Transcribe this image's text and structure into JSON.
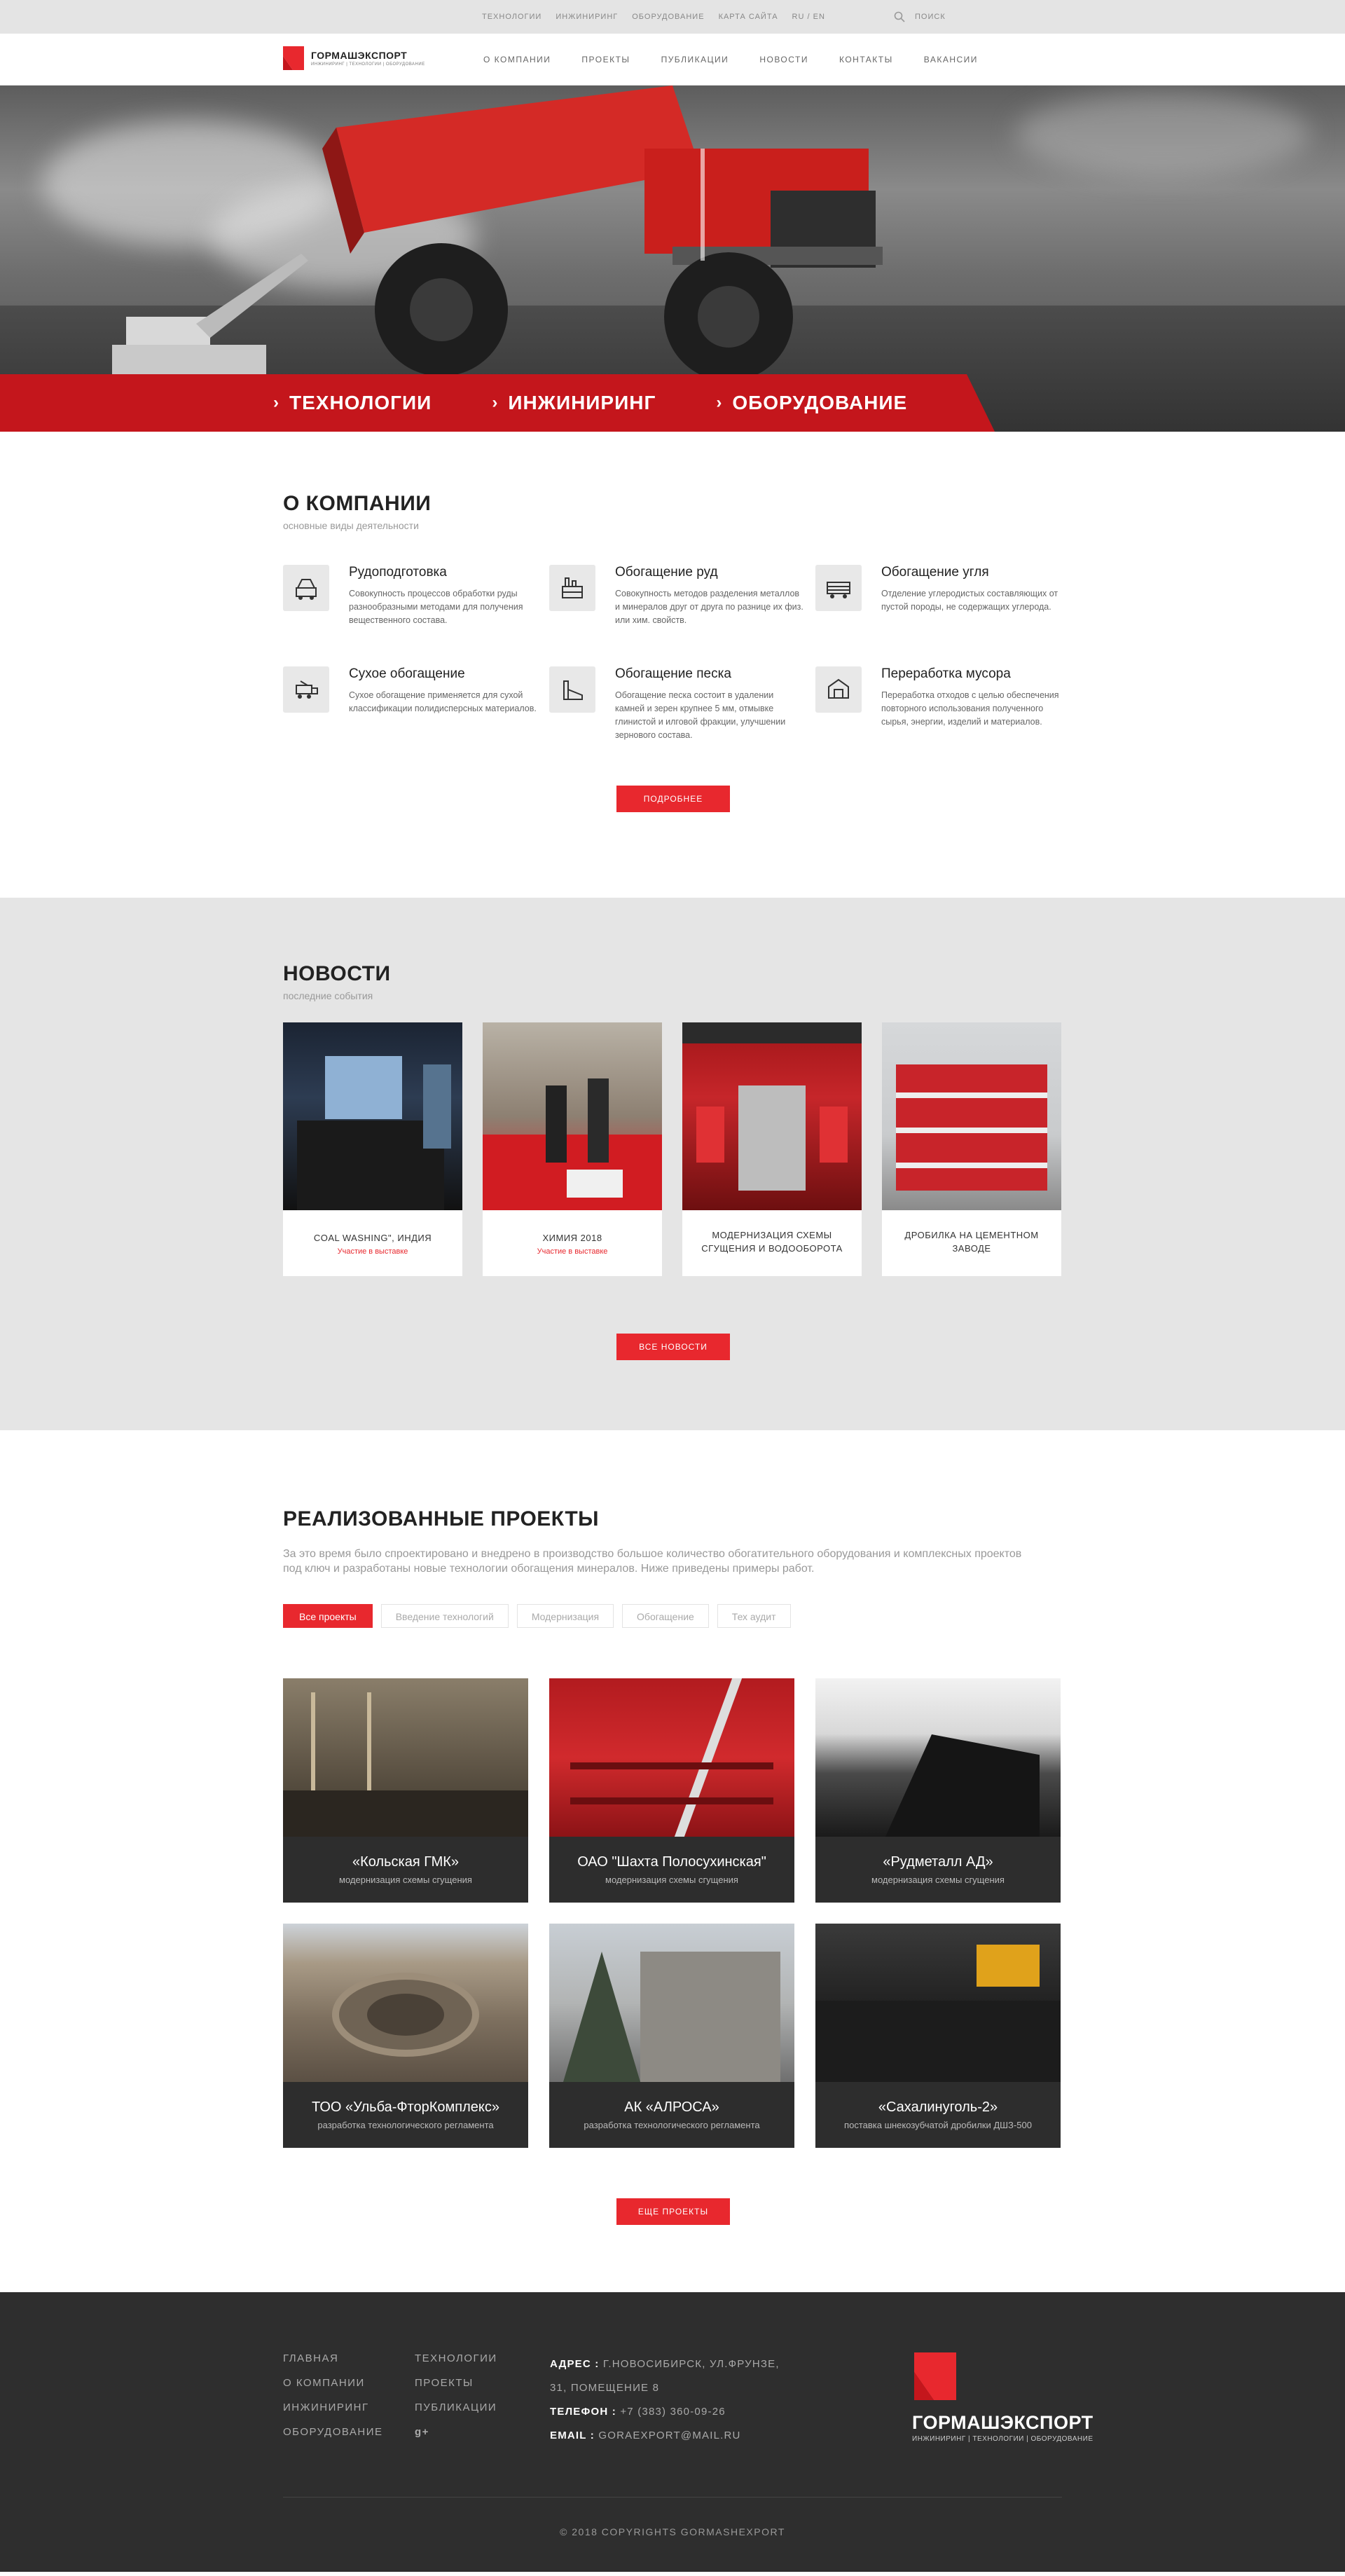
{
  "topbar": {
    "links": [
      "ТЕХНОЛОГИИ",
      "ИНЖИНИРИНГ",
      "ОБОРУДОВАНИЕ",
      "КАРТА САЙТА",
      "RU / EN"
    ],
    "search_label": "ПОИСК"
  },
  "header": {
    "logo_name": "ГОРМАШЭКСПОРТ",
    "logo_tagline": "ИНЖИНИРИНГ | ТЕХНОЛОГИИ | ОБОРУДОВАНИЕ",
    "nav": [
      "О КОМПАНИИ",
      "ПРОЕКТЫ",
      "ПУБЛИКАЦИИ",
      "НОВОСТИ",
      "КОНТАКТЫ",
      "ВАКАНСИИ"
    ]
  },
  "hero": {
    "items": [
      "ТЕХНОЛОГИИ",
      "ИНЖИНИРИНГ",
      "ОБОРУДОВАНИЕ"
    ]
  },
  "company": {
    "title": "О КОМПАНИИ",
    "subtitle": "основные виды деятельности",
    "services": [
      {
        "title": "Рудоподготовка",
        "text": "Совокупность процессов обработки руды разнообразными методами для получения вещественного состава.",
        "icon": "crusher-icon"
      },
      {
        "title": "Обогащение руд",
        "text": "Совокупность методов разделения металлов и минералов друг от друга по разнице их физ. или хим. свойств.",
        "icon": "factory-icon"
      },
      {
        "title": "Обогащение угля",
        "text": "Отделение углеродистых составляющих от пустой породы, не содержащих углерода.",
        "icon": "coal-wagon-icon"
      },
      {
        "title": "Сухое обогащение",
        "text": "Сухое обогащение применяется для сухой классификации полидисперсных материалов.",
        "icon": "conveyor-icon"
      },
      {
        "title": "Обогащение песка",
        "text": "Обогащение песка состоит в удалении камней и зерен крупнее 5 мм, отмывке глинистой и илговой фракции, улучшении зернового состава.",
        "icon": "plant-icon"
      },
      {
        "title": "Переработка мусора",
        "text": "Переработка отходов с целью обеспечения повторного использования полученного сырья, энергии, изделий и материалов.",
        "icon": "recycling-icon"
      }
    ],
    "button": "ПОДРОБНЕЕ"
  },
  "news": {
    "title": "НОВОСТИ",
    "subtitle": "последние события",
    "items": [
      {
        "title": "COAL WASHING\", ИНДИЯ",
        "tag": "Участие в выставке"
      },
      {
        "title": "ХИМИЯ 2018",
        "tag": "Участие в выставке"
      },
      {
        "title": "МОДЕРНИЗАЦИЯ СХЕМЫ СГУЩЕНИЯ И ВОДООБОРОТА",
        "tag": ""
      },
      {
        "title": "ДРОБИЛКА НА ЦЕМЕНТНОМ ЗАВОДЕ",
        "tag": ""
      }
    ],
    "button": "ВСЕ НОВОСТИ"
  },
  "projects": {
    "title": "РЕАЛИЗОВАННЫЕ ПРОЕКТЫ",
    "lead": "За это время было спроектировано и внедрено в производство большое количество обогатительного оборудования и комплексных проектов под ключ и разработаны новые технологии обогащения минералов. Ниже приведены примеры работ.",
    "filters": [
      "Все проекты",
      "Введение технологий",
      "Модернизация",
      "Обогащение",
      "Тех аудит"
    ],
    "items": [
      {
        "title": "«Кольская ГМК»",
        "sub": "модернизация схемы сгущения"
      },
      {
        "title": "ОАО \"Шахта Полосухинская\"",
        "sub": "модернизация схемы сгущения"
      },
      {
        "title": "«Рудметалл АД»",
        "sub": "модернизация схемы сгущения"
      },
      {
        "title": "ТОО «Ульба-ФторКомплекс»",
        "sub": "разработка технологического регламента"
      },
      {
        "title": "АК «АЛРОСА»",
        "sub": "разработка технологического регламента"
      },
      {
        "title": "«Сахалинуголь-2»",
        "sub": "поставка шнекозубчатой дробилки ДШЗ-500"
      }
    ],
    "button": "ЕЩЕ ПРОЕКТЫ"
  },
  "footer": {
    "col1": [
      "ГЛАВНАЯ",
      "О КОМПАНИИ",
      "ИНЖИНИРИНГ",
      "ОБОРУДОВАНИЕ"
    ],
    "col2": [
      "ТЕХНОЛОГИИ",
      "ПРОЕКТЫ",
      "ПУБЛИКАЦИИ"
    ],
    "social_icon": "google-plus-icon",
    "address_label": "АДРЕС :",
    "address": "Г.НОВОСИБИРСК, УЛ.ФРУНЗЕ, 31, ПОМЕЩЕНИЕ 8",
    "phone_label": "ТЕЛЕФОН :",
    "phone": "+7 (383) 360-09-26",
    "email_label": "EMAIL :",
    "email": "GORAEXPORT@MAIL.RU",
    "logo_name": "ГОРМАШЭКСПОРТ",
    "logo_tagline": "ИНЖИНИРИНГ | ТЕХНОЛОГИИ | ОБОРУДОВАНИЕ",
    "copyright": "© 2018 COPYRIGHTS GORMASHEXPORT"
  },
  "colors": {
    "accent": "#e8282e",
    "hero_bar": "#c4161c",
    "footer_bg": "#2e2e2e",
    "news_bg": "#e5e5e5"
  }
}
